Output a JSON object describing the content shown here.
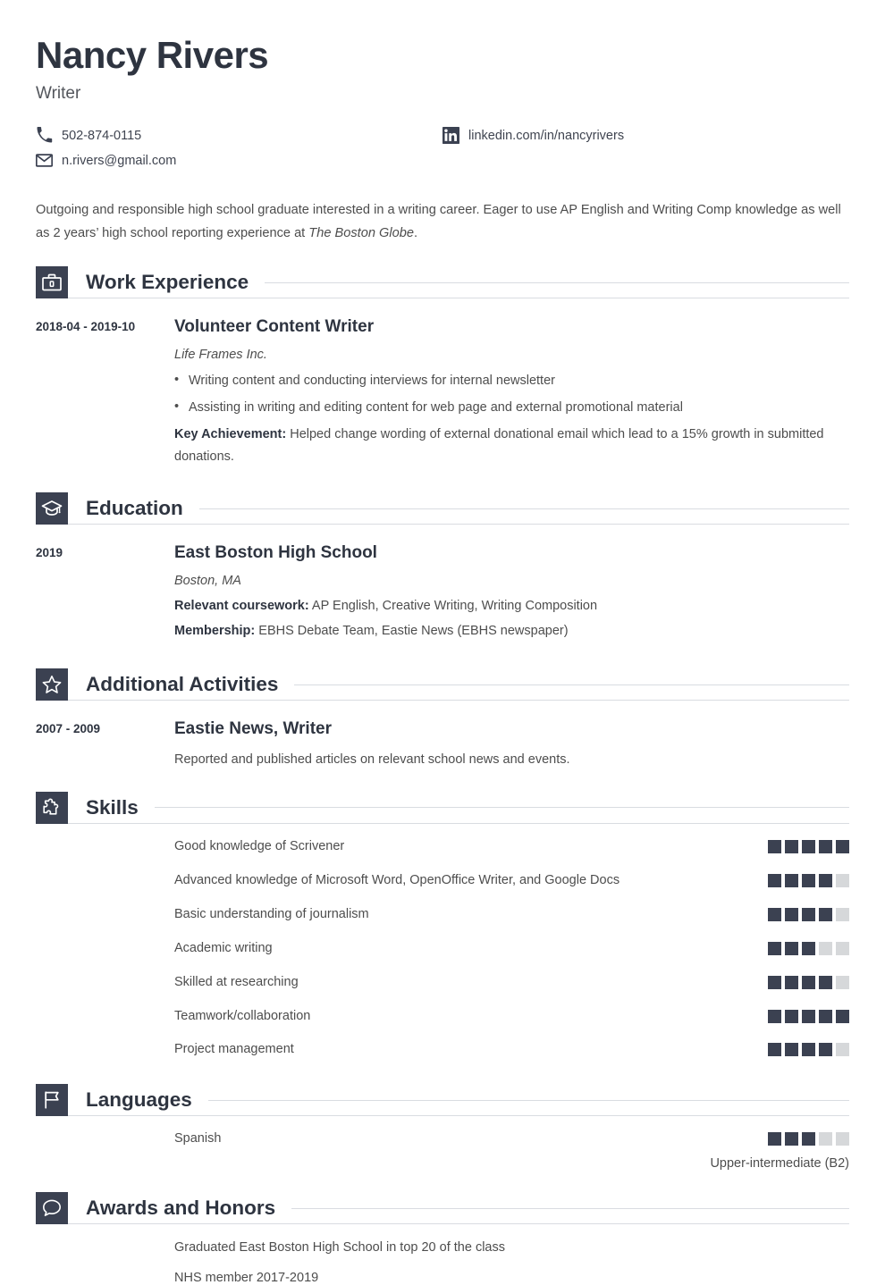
{
  "header": {
    "name": "Nancy Rivers",
    "job_title": "Writer",
    "contacts": [
      {
        "icon": "phone-icon",
        "text": "502-874-0115"
      },
      {
        "icon": "linkedin-icon",
        "text": "linkedin.com/in/nancyrivers"
      },
      {
        "icon": "email-icon",
        "text": "n.rivers@gmail.com"
      }
    ]
  },
  "summary": {
    "part1": "Outgoing and responsible high school graduate interested in a writing career. Eager to use AP English and Writing Comp knowledge as well as 2 years’ high school reporting experience at ",
    "italic": "The Boston Globe",
    "part2": "."
  },
  "sections": {
    "work": {
      "title": "Work Experience",
      "icon": "briefcase-icon",
      "entry": {
        "date": "2018-04 - 2019-10",
        "title": "Volunteer Content Writer",
        "company": "Life Frames Inc.",
        "bullets": [
          "Writing content and conducting interviews for internal newsletter",
          "Assisting in writing and editing content for web page and external promotional material"
        ],
        "achievement_label": "Key Achievement:",
        "achievement_text": " Helped change wording of external donational email which lead to a 15% growth in submitted donations."
      }
    },
    "education": {
      "title": "Education",
      "icon": "graduation-cap-icon",
      "entry": {
        "date": "2019",
        "school": "East Boston High School",
        "location": "Boston, MA",
        "coursework_label": "Relevant coursework:",
        "coursework_text": " AP English, Creative Writing, Writing Composition",
        "membership_label": "Membership:",
        "membership_text": " EBHS Debate Team, Eastie News (EBHS newspaper)"
      }
    },
    "activities": {
      "title": "Additional Activities",
      "icon": "star-icon",
      "entry": {
        "date": "2007 - 2009",
        "title": "Eastie News, Writer",
        "description": "Reported and published articles on relevant school news and events."
      }
    },
    "skills": {
      "title": "Skills",
      "icon": "puzzle-icon",
      "max_rating": 5,
      "items": [
        {
          "label": "Good knowledge of Scrivener",
          "rating": 5
        },
        {
          "label": "Advanced knowledge of Microsoft Word, OpenOffice Writer, and Google Docs",
          "rating": 4
        },
        {
          "label": "Basic understanding of journalism",
          "rating": 4
        },
        {
          "label": "Academic writing",
          "rating": 3
        },
        {
          "label": "Skilled at researching",
          "rating": 4
        },
        {
          "label": "Teamwork/collaboration",
          "rating": 5
        },
        {
          "label": "Project management",
          "rating": 4
        }
      ]
    },
    "languages": {
      "title": "Languages",
      "icon": "flag-icon",
      "max_rating": 5,
      "items": [
        {
          "label": "Spanish",
          "rating": 3,
          "level": "Upper-intermediate (B2)"
        }
      ]
    },
    "awards": {
      "title": "Awards and Honors",
      "icon": "speech-bubble-icon",
      "items": [
        "Graduated East Boston High School in top 20 of the class",
        "NHS member 2017-2019"
      ]
    }
  },
  "colors": {
    "accent_dark": "#3b4151",
    "text_heading": "#2e3440",
    "text_body": "#4d4d4d",
    "rule": "#d9dce1",
    "box_empty": "#d6d8da"
  }
}
